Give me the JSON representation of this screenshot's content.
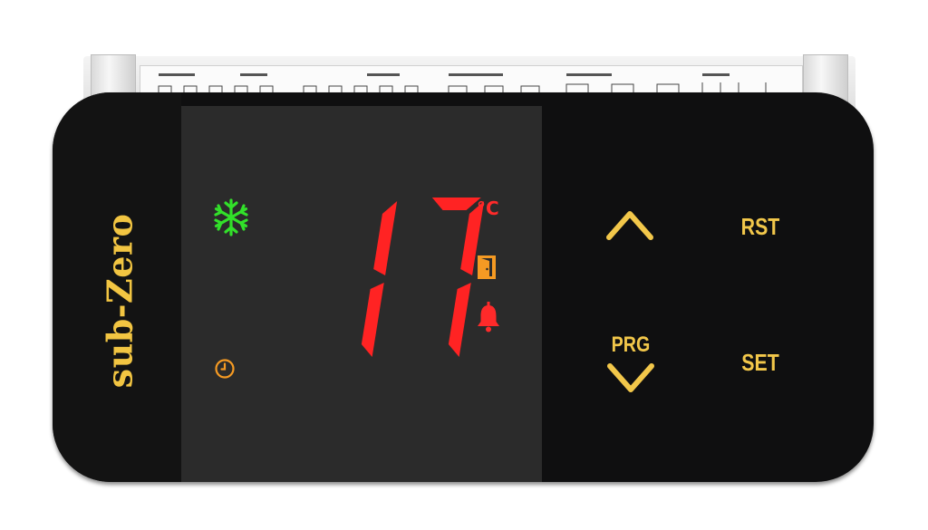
{
  "device": {
    "brand": "sub-Zero",
    "temperature": "17",
    "unit": "°C",
    "indicators": {
      "snowflake": "snowflake-icon",
      "clock": "clock-icon",
      "door": "door-icon",
      "alarm": "bell-icon"
    },
    "colors": {
      "digits": "#ff2323",
      "snowflake": "#32e02a",
      "accent": "#f2c74a",
      "indicator_orange": "#f59a23",
      "panel": "#0f0f10",
      "display_window": "#2b2b2b"
    }
  },
  "buttons": {
    "up": {
      "icon": "chevron-up-icon"
    },
    "rst": {
      "label": "RST"
    },
    "prg": {
      "label": "PRG",
      "icon": "chevron-down-icon"
    },
    "set": {
      "label": "SET"
    }
  }
}
